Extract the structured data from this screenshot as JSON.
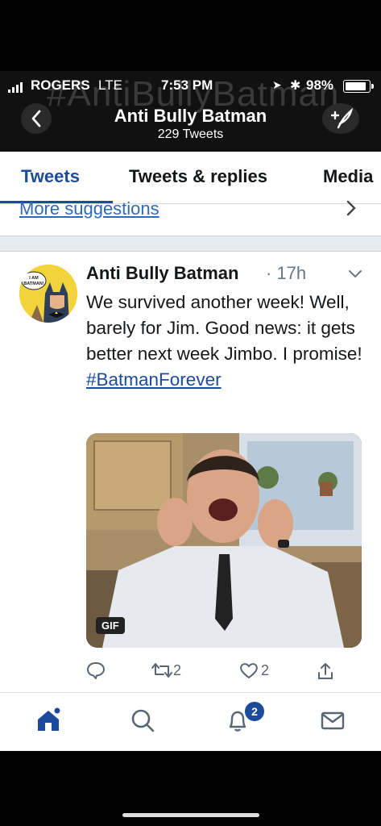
{
  "status_bar": {
    "carrier": "ROGERS",
    "network": "LTE",
    "time": "7:53 PM",
    "battery_percent": "98%",
    "battery_level": 0.98
  },
  "watermark": "#AntiBullyBatman",
  "header": {
    "profile_name": "Anti Bully Batman",
    "tweet_count": "229 Tweets",
    "back_icon": "chevron-left-icon",
    "compose_icon": "compose-icon"
  },
  "tabs": [
    {
      "label": "Tweets",
      "active": true
    },
    {
      "label": "Tweets & replies",
      "active": false
    },
    {
      "label": "Media",
      "active": false
    }
  ],
  "more_suggestions": "More suggestions",
  "tweet": {
    "avatar_text": "I AM BATMAN!",
    "author": "Anti Bully Batman",
    "time": "· 17h",
    "text": "We survived another week! Well, barely for Jim. Good news: it gets better next week Jimbo. I promise!",
    "hashtag": "#BatmanForever",
    "media_badge": "GIF",
    "retweets": "2",
    "likes": "2"
  },
  "bottom_nav": {
    "notifications_badge": "2",
    "active_color": "#1c4b9b"
  }
}
